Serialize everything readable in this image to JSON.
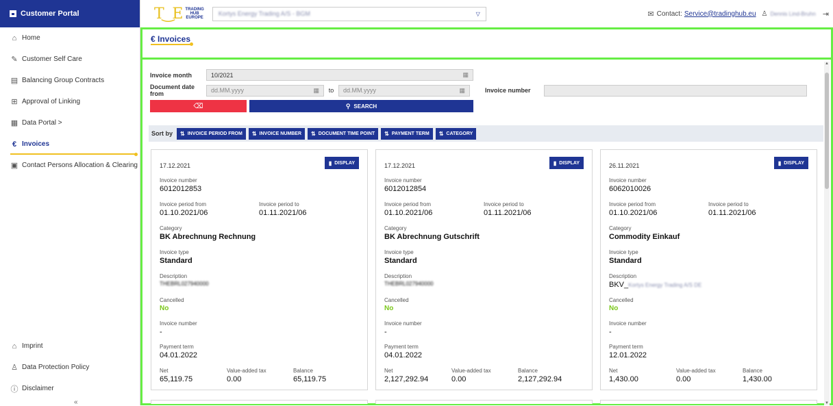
{
  "sidebar": {
    "header": "Customer Portal",
    "items": [
      {
        "label": "Home",
        "icon": "home-icon"
      },
      {
        "label": "Customer Self Care",
        "icon": "edit-icon"
      },
      {
        "label": "Balancing Group Contracts",
        "icon": "document-icon"
      },
      {
        "label": "Approval of Linking",
        "icon": "network-icon"
      },
      {
        "label": "Data Portal >",
        "icon": "table-icon"
      },
      {
        "label": "Invoices",
        "icon": "euro-icon"
      },
      {
        "label": "Contact Persons Allocation & Clearing",
        "icon": "contact-card-icon"
      }
    ],
    "bottom_items": [
      {
        "label": "Imprint",
        "icon": "bank-icon"
      },
      {
        "label": "Data Protection Policy",
        "icon": "users-icon"
      },
      {
        "label": "Disclaimer",
        "icon": "info-icon"
      }
    ],
    "collapse_glyph": "«"
  },
  "topbar": {
    "brand_words": [
      "TRADING",
      "HUB",
      "EUROPE"
    ],
    "company_selected": "Kortys Energy Trading A/S - BGM",
    "contact_label": "Contact:",
    "contact_email": "Service@tradinghub.eu",
    "user_name": "Dennis Lind-Bruhn"
  },
  "page": {
    "title": "€ Invoices"
  },
  "filters": {
    "invoice_month_label": "Invoice month",
    "invoice_month_value": "10/2021",
    "doc_date_from_label": "Document date from",
    "doc_date_from_placeholder": "dd.MM.yyyy",
    "to_label": "to",
    "doc_date_to_placeholder": "dd.MM.yyyy",
    "invoice_number_label": "Invoice number",
    "invoice_number_value": "",
    "search_label": "SEARCH"
  },
  "sort": {
    "label": "Sort by",
    "buttons": [
      "INVOICE PERIOD FROM",
      "INVOICE NUMBER",
      "DOCUMENT TIME POINT",
      "PAYMENT TERM",
      "CATEGORY"
    ]
  },
  "labels": {
    "display": "DISPLAY",
    "invoice_number": "Invoice number",
    "period_from": "Invoice period from",
    "period_to": "Invoice period to",
    "category": "Category",
    "invoice_type": "Invoice type",
    "description": "Description",
    "cancelled": "Cancelled",
    "invoice_number_2": "Invoice number",
    "payment_term": "Payment term",
    "net": "Net",
    "vat": "Value-added tax",
    "balance": "Balance"
  },
  "cards": [
    {
      "date": "17.12.2021",
      "invoice_number": "6012012853",
      "period_from": "01.10.2021/06",
      "period_to": "01.11.2021/06",
      "category": "BK Abrechnung Rechnung",
      "invoice_type": "Standard",
      "description": "THEBRL027940000",
      "cancelled": "No",
      "invoice_number_2": "-",
      "payment_term": "04.01.2022",
      "net": "65,119.75",
      "vat": "0.00",
      "balance": "65,119.75"
    },
    {
      "date": "17.12.2021",
      "invoice_number": "6012012854",
      "period_from": "01.10.2021/06",
      "period_to": "01.11.2021/06",
      "category": "BK Abrechnung Gutschrift",
      "invoice_type": "Standard",
      "description": "THEBRL027940000",
      "cancelled": "No",
      "invoice_number_2": "-",
      "payment_term": "04.01.2022",
      "net": "2,127,292.94",
      "vat": "0.00",
      "balance": "2,127,292.94"
    },
    {
      "date": "26.11.2021",
      "invoice_number": "6062010026",
      "period_from": "01.10.2021/06",
      "period_to": "01.11.2021/06",
      "category": "Commodity Einkauf",
      "invoice_type": "Standard",
      "description_prefix": "BKV_",
      "description": "Kortys Energy Trading A/S DE",
      "cancelled": "No",
      "invoice_number_2": "-",
      "payment_term": "12.01.2022",
      "net": "1,430.00",
      "vat": "0.00",
      "balance": "1,430.00"
    }
  ],
  "colors": {
    "primary": "#1f3594",
    "accent": "#f0c020",
    "clear": "#ee3344",
    "cancelled_no": "#7ac71a",
    "frame": "#66ee44"
  }
}
